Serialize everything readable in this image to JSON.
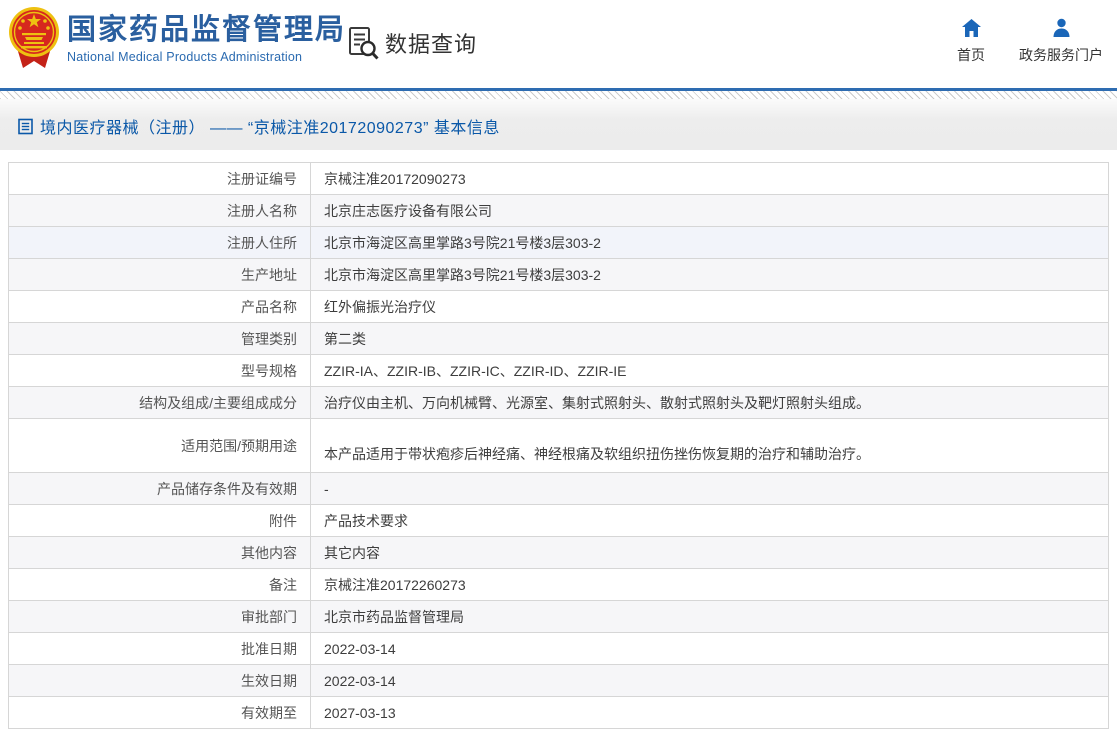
{
  "header": {
    "org_name_zh": "国家药品监督管理局",
    "org_name_en": "National Medical Products Administration",
    "data_query_label": "数据查询",
    "nav": [
      {
        "label": "首页",
        "icon": "home-icon"
      },
      {
        "label": "政务服务门户",
        "icon": "user-icon"
      }
    ]
  },
  "breadcrumb": {
    "icon": "doc-list-icon",
    "text": "境内医疗器械（注册） —— “京械注准20172090273” 基本信息"
  },
  "table": {
    "rows": [
      {
        "label": "注册证编号",
        "value": "京械注准20172090273"
      },
      {
        "label": "注册人名称",
        "value": "北京庄志医疗设备有限公司"
      },
      {
        "label": "注册人住所",
        "value": "北京市海淀区高里掌路3号院21号楼3层303-2"
      },
      {
        "label": "生产地址",
        "value": "北京市海淀区高里掌路3号院21号楼3层303-2"
      },
      {
        "label": "产品名称",
        "value": "红外偏振光治疗仪"
      },
      {
        "label": "管理类别",
        "value": "第二类"
      },
      {
        "label": "型号规格",
        "value": "ZZIR-IA、ZZIR-IB、ZZIR-IC、ZZIR-ID、ZZIR-IE"
      },
      {
        "label": "结构及组成/主要组成成分",
        "value": "治疗仪由主机、万向机械臂、光源室、集射式照射头、散射式照射头及靶灯照射头组成。"
      },
      {
        "label": "适用范围/预期用途",
        "value": "本产品适用于带状疱疹后神经痛、神经根痛及软组织扭伤挫伤恢复期的治疗和辅助治疗。"
      },
      {
        "label": "产品储存条件及有效期",
        "value": "-"
      },
      {
        "label": "附件",
        "value": "产品技术要求"
      },
      {
        "label": "其他内容",
        "value": "其它内容"
      },
      {
        "label": "备注",
        "value": "京械注准20172260273"
      },
      {
        "label": "审批部门",
        "value": "北京市药品监督管理局"
      },
      {
        "label": "批准日期",
        "value": "2022-03-14"
      },
      {
        "label": "生效日期",
        "value": "2022-03-14"
      },
      {
        "label": "有效期至",
        "value": "2027-03-13"
      }
    ]
  },
  "colors": {
    "title_blue": "#2a5f9f",
    "link_blue": "#0a58a8",
    "icon_blue": "#1a66b8",
    "header_rule_blue": "#2e6cb1",
    "band_gray": "#ececec",
    "row_alt_gray": "#f6f6f8",
    "row_hover_blue": "#f2f4fa",
    "table_border": "#d6d6d6",
    "emblem_red": "#d6281e",
    "emblem_gold": "#eec111"
  }
}
